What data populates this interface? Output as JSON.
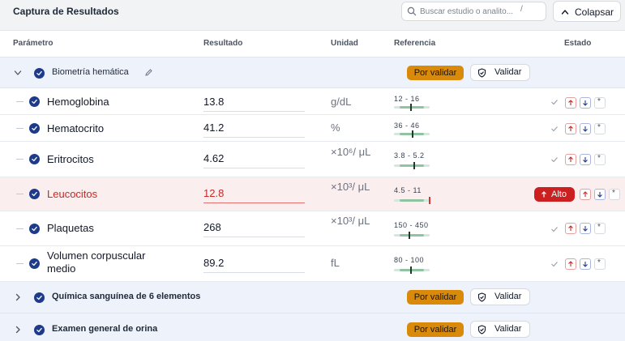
{
  "header": {
    "title": "Captura de Resultados",
    "search_placeholder": "Buscar estudio o analito...",
    "search_shortcut": "/",
    "collapse_label": "Colapsar"
  },
  "columns": {
    "param": "Parámetro",
    "result": "Resultado",
    "unit": "Unidad",
    "reference": "Referencia",
    "status": "Estado"
  },
  "groups": [
    {
      "name": "Biometría hemática",
      "expanded": true,
      "badge": "Por validar",
      "validate_label": "Validar",
      "rows": [
        {
          "name": "Hemoglobina",
          "value": "13.8",
          "unit": "g/dL",
          "ref": "12 - 16",
          "ref_low": 12,
          "ref_high": 16,
          "flag": ""
        },
        {
          "name": "Hematocrito",
          "value": "41.2",
          "unit": "%",
          "ref": "36 - 46",
          "ref_low": 36,
          "ref_high": 46,
          "flag": ""
        },
        {
          "name": "Eritrocitos",
          "value": "4.62",
          "unit": "×10⁶/ μL",
          "ref": "3.8 - 5.2",
          "ref_low": 3.8,
          "ref_high": 5.2,
          "flag": ""
        },
        {
          "name": "Leucocitos",
          "value": "12.8",
          "unit": "×10³/ μL",
          "ref": "4.5 - 11",
          "ref_low": 4.5,
          "ref_high": 11,
          "flag": "Alto"
        },
        {
          "name": "Plaquetas",
          "value": "268",
          "unit": "×10³/ μL",
          "ref": "150 - 450",
          "ref_low": 150,
          "ref_high": 450,
          "flag": ""
        },
        {
          "name": "Volumen corpuscular medio",
          "value": "89.2",
          "unit": "fL",
          "ref": "80 - 100",
          "ref_low": 80,
          "ref_high": 100,
          "flag": ""
        }
      ]
    },
    {
      "name": "Química sanguínea de 6 elementos",
      "expanded": false,
      "badge": "Por validar",
      "validate_label": "Validar"
    },
    {
      "name": "Examen general de orina",
      "expanded": false,
      "badge": "Por validar",
      "validate_label": "Validar"
    }
  ],
  "icons": {
    "star_glyph": "*",
    "search": "search-icon",
    "collapse": "chevron-up-icon",
    "validate": "shield-check-icon",
    "edit": "pencil-icon",
    "mark_high": "arrow-up-icon",
    "mark_low": "arrow-down-icon"
  },
  "colors": {
    "accent": "#1e3a8a",
    "pending": "#d98a0b",
    "alert": "#cc1f1f",
    "alert_row_bg": "#fbeeee",
    "group_bg": "#eef2fb"
  }
}
